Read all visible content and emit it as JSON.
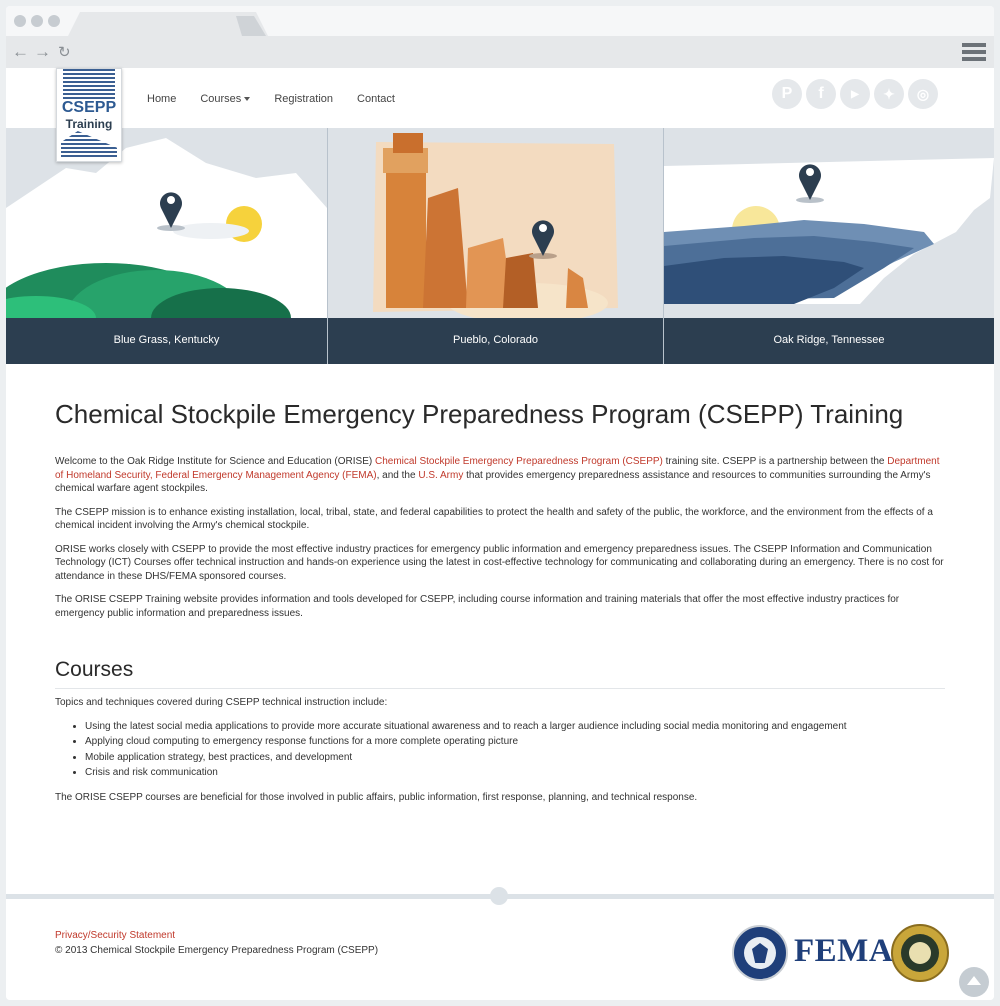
{
  "nav": {
    "home": "Home",
    "courses": "Courses",
    "registration": "Registration",
    "contact": "Contact"
  },
  "logo": {
    "line1": "CSEPP",
    "line2": "Training"
  },
  "social": [
    "pinterest-icon",
    "facebook-icon",
    "youtube-icon",
    "twitter-icon",
    "instagram-icon"
  ],
  "locations": [
    {
      "name": "Blue Grass, Kentucky"
    },
    {
      "name": "Pueblo, Colorado"
    },
    {
      "name": "Oak Ridge, Tennessee"
    }
  ],
  "main": {
    "title": "Chemical Stockpile Emergency Preparedness Program (CSEPP) Training",
    "p1": {
      "a": "Welcome to the Oak Ridge Institute for Science and Education (ORISE) ",
      "link1": "Chemical Stockpile Emergency Preparedness Program (CSEPP)",
      "b": " training site. CSEPP is a partnership between the ",
      "link2": "Department of Homeland Security, Federal Emergency Management Agency (FEMA)",
      "c": ", and the ",
      "link3": "U.S. Army",
      "d": " that provides emergency preparedness assistance and resources to communities surrounding the Army's chemical warfare agent stockpiles."
    },
    "p2": "The CSEPP mission is to enhance existing installation, local, tribal, state, and federal capabilities to protect the health and safety of the public, the workforce, and the environment from the effects of a chemical incident involving the Army's chemical stockpile.",
    "p3": "ORISE works closely with CSEPP to provide the most effective industry practices for emergency public information and emergency preparedness issues. The CSEPP Information and Communication Technology (ICT) Courses offer technical instruction and hands-on experience using the latest in cost-effective technology for communicating and collaborating during an emergency. There is no cost for attendance in these DHS/FEMA sponsored courses.",
    "p4": "The ORISE CSEPP Training website provides information and tools developed for CSEPP, including course information and training materials that offer the most effective industry practices for emergency public information and preparedness issues."
  },
  "courses": {
    "heading": "Courses",
    "intro": "Topics and techniques covered during CSEPP technical instruction include:",
    "items": [
      "Using the latest social media applications to provide more accurate situational awareness and to reach a larger audience including social media monitoring and engagement",
      "Applying cloud computing to emergency response functions for a more complete operating picture",
      "Mobile application strategy, best practices, and development",
      "Crisis and risk communication"
    ],
    "outro": "The ORISE CSEPP courses are beneficial for those involved in public affairs, public information, first response, planning, and technical response."
  },
  "footer": {
    "privacy": "Privacy/Security Statement",
    "copyright": "© 2013 Chemical Stockpile Emergency Preparedness Program (CSEPP)",
    "fema": "FEMA"
  }
}
